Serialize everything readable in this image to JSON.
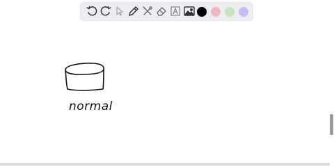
{
  "toolbar": {
    "tools": [
      {
        "name": "undo-icon"
      },
      {
        "name": "redo-icon"
      },
      {
        "name": "select-pointer-icon"
      },
      {
        "name": "pen-icon"
      },
      {
        "name": "tools-icon"
      },
      {
        "name": "eraser-icon"
      },
      {
        "name": "text-box-icon"
      },
      {
        "name": "image-icon"
      }
    ],
    "colors": {
      "black": "#000000",
      "pink": "#f1b6c4",
      "green": "#c3e6bd",
      "lavender": "#c7bdf0"
    }
  },
  "drawing": {
    "handwritten_label": "normal"
  }
}
